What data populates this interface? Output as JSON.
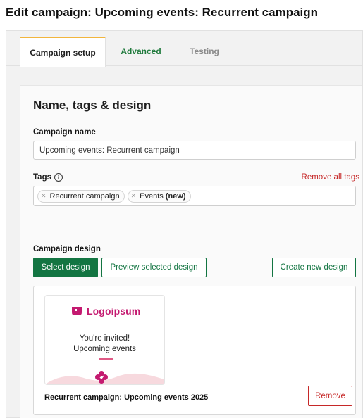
{
  "page": {
    "title": "Edit campaign: Upcoming events: Recurrent campaign"
  },
  "tabs": [
    {
      "label": "Campaign setup",
      "state": "active"
    },
    {
      "label": "Advanced",
      "state": "default"
    },
    {
      "label": "Testing",
      "state": "disabled"
    }
  ],
  "section": {
    "title": "Name, tags & design"
  },
  "campaign_name": {
    "label": "Campaign name",
    "value": "Upcoming events: Recurrent campaign"
  },
  "tags": {
    "label": "Tags",
    "info_icon": "info-icon",
    "remove_all_label": "Remove all tags",
    "items": [
      {
        "name": "Recurrent campaign",
        "badge": ""
      },
      {
        "name": "Events",
        "badge": "(new)"
      }
    ]
  },
  "design": {
    "label": "Campaign design",
    "select_label": "Select design",
    "preview_label": "Preview selected design",
    "create_label": "Create new design",
    "thumbnail": {
      "logo_text": "Logoipsum",
      "line1": "You're invited!",
      "line2": "Upcoming events"
    },
    "selected_name": "Recurrent campaign: Upcoming events 2025",
    "remove_label": "Remove"
  },
  "colors": {
    "accent_green": "#137542",
    "tab_active_border": "#f2b53c",
    "danger_red": "#c62828",
    "logo_pink": "#c41a70"
  }
}
